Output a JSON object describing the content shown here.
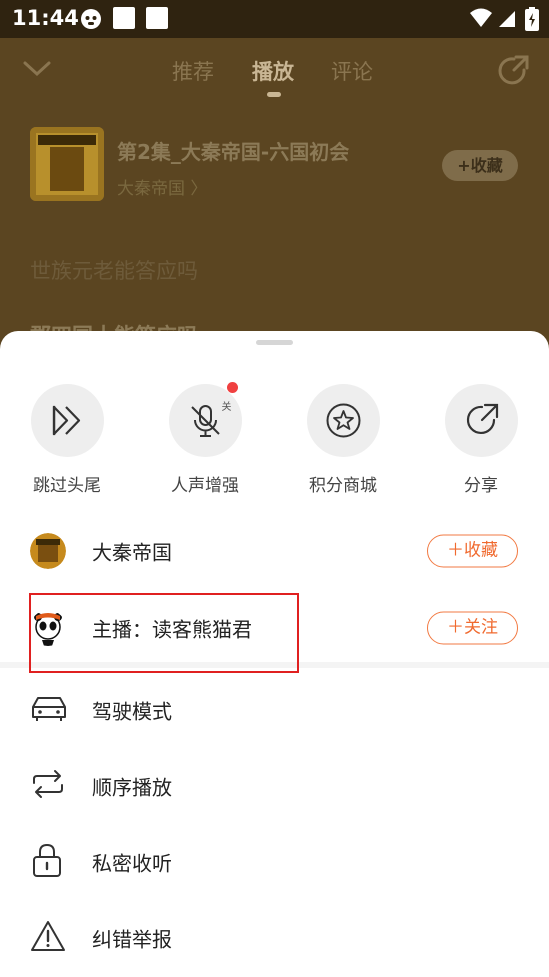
{
  "status": {
    "time": "11:44"
  },
  "tabs": [
    {
      "label": "推荐"
    },
    {
      "label": "播放"
    },
    {
      "label": "评论"
    }
  ],
  "album": {
    "title": "第2集_大秦帝国-六国初会",
    "name": "大秦帝国 〉",
    "collect_label": "+收藏"
  },
  "bg_text": {
    "line1": "世族元老能答应吗",
    "line2": "郡四国十能答应吗"
  },
  "actions": [
    {
      "label": "跳过头尾",
      "icon": "skip-icon"
    },
    {
      "label": "人声增强",
      "icon": "voice-enhance-icon",
      "badge": "关"
    },
    {
      "label": "积分商城",
      "icon": "star-icon"
    },
    {
      "label": "分享",
      "icon": "share-icon"
    }
  ],
  "album_row": {
    "label": "大秦帝国",
    "button": "收藏"
  },
  "host_row": {
    "label": "主播：读客熊猫君",
    "button": "关注"
  },
  "menu": [
    {
      "label": "驾驶模式",
      "icon": "car-icon"
    },
    {
      "label": "顺序播放",
      "icon": "repeat-icon"
    },
    {
      "label": "私密收听",
      "icon": "lock-icon"
    },
    {
      "label": "纠错举报",
      "icon": "warning-icon"
    }
  ],
  "colors": {
    "accent": "#f06a2f",
    "highlight": "#e02020"
  }
}
